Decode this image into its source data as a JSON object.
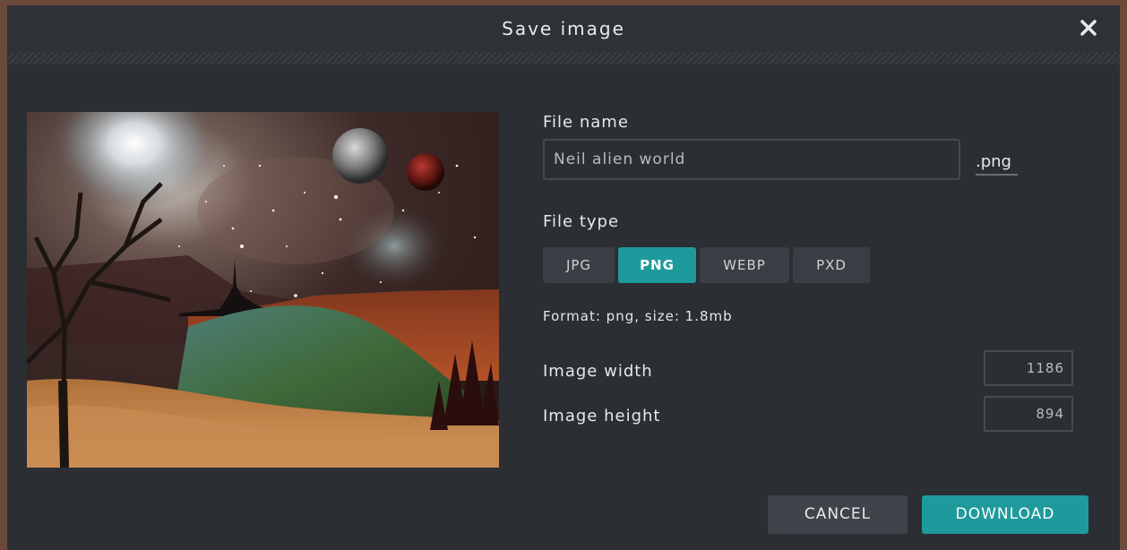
{
  "dialog": {
    "title": "Save image",
    "close_icon": "close-icon"
  },
  "form": {
    "file_name_label": "File name",
    "file_name_value": "Neil alien world",
    "extension": ".png",
    "file_type_label": "File type",
    "file_types": [
      "JPG",
      "PNG",
      "WEBP",
      "PXD"
    ],
    "selected_type": "PNG",
    "format_info": "Format: png, size: 1.8mb",
    "width_label": "Image width",
    "width_value": "1186",
    "height_label": "Image height",
    "height_value": "894"
  },
  "actions": {
    "cancel_label": "CANCEL",
    "download_label": "DOWNLOAD"
  },
  "colors": {
    "accent": "#1e9a9c",
    "dialog_bg": "#2b2e33",
    "button_bg": "#3b3f45"
  }
}
